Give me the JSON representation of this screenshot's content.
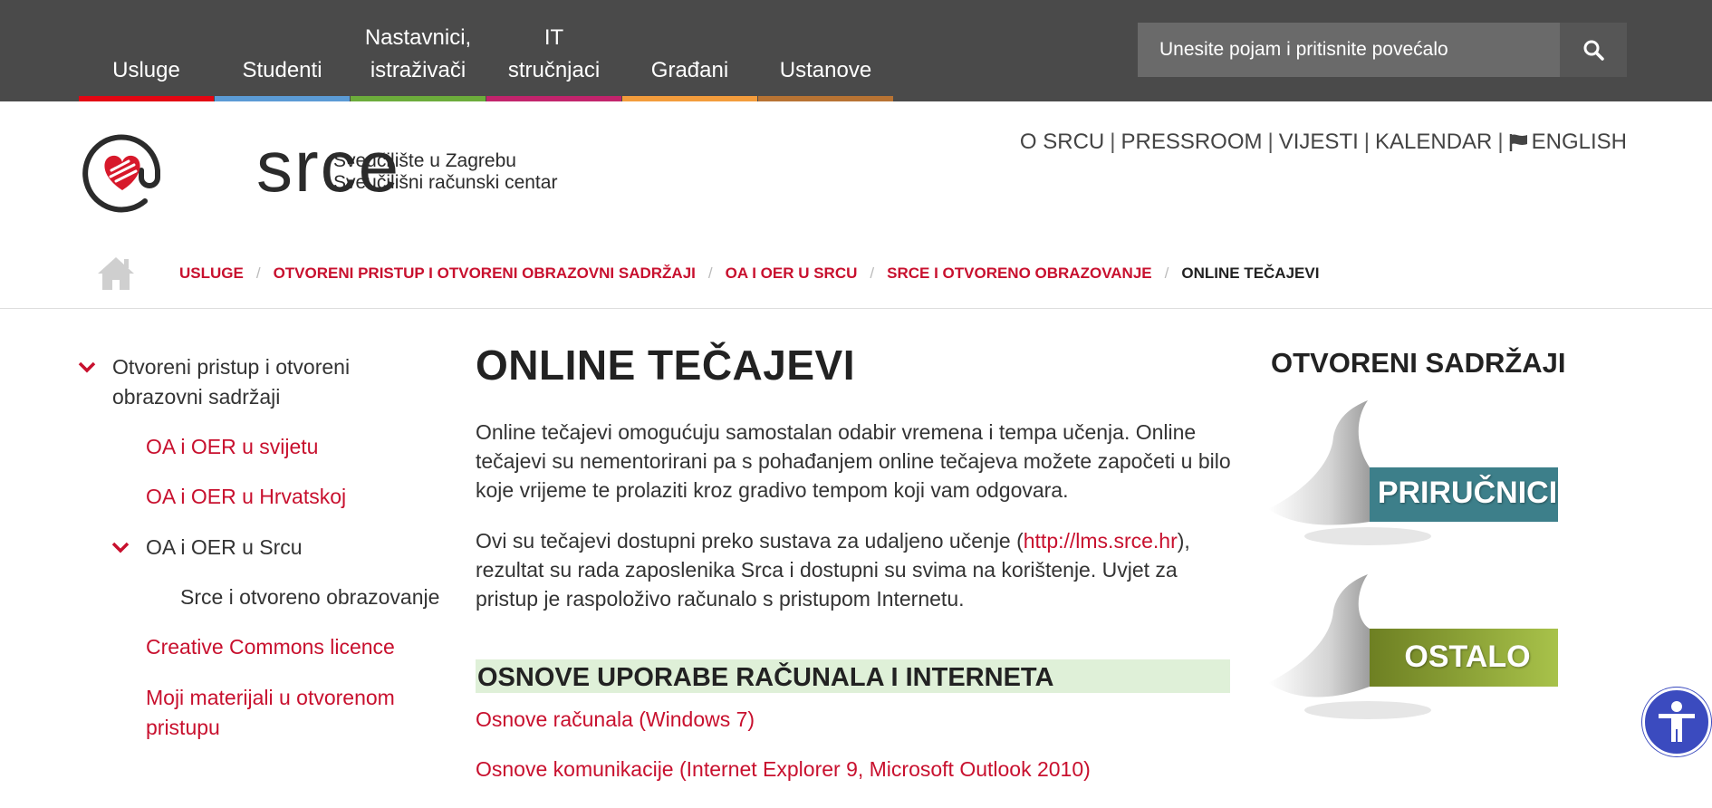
{
  "nav": {
    "items": [
      {
        "line1": "",
        "line2": "Usluge",
        "color": "#e30613"
      },
      {
        "line1": "",
        "line2": "Studenti",
        "color": "#5b9bd5"
      },
      {
        "line1": "Nastavnici,",
        "line2": "istraživači",
        "color": "#6cac3b"
      },
      {
        "line1": "IT",
        "line2": "stručnjaci",
        "color": "#c2246c"
      },
      {
        "line1": "",
        "line2": "Građani",
        "color": "#f39c3c"
      },
      {
        "line1": "",
        "line2": "Ustanove",
        "color": "#b87333"
      }
    ],
    "search_placeholder": "Unesite pojam i pritisnite povećalo",
    "search_icon": "magnifier-icon"
  },
  "header": {
    "logo_text": "srce",
    "logo_sub1": "Sveučilište u Zagrebu",
    "logo_sub2": "Sveučilišni računski centar",
    "links": [
      "O SRCU",
      "PRESSROOM",
      "VIJESTI",
      "KALENDAR",
      "ENGLISH"
    ],
    "separator": "|"
  },
  "breadcrumb": {
    "items": [
      "USLUGE",
      "OTVORENI PRISTUP I OTVORENI OBRAZOVNI SADRŽAJI",
      "OA I OER U SRCU",
      "SRCE I OTVORENO OBRAZOVANJE"
    ],
    "current": "ONLINE TEČAJEVI",
    "separator": "/"
  },
  "sidebar": {
    "parent1": "Otvoreni pristup i otvoreni",
    "parent2": "obrazovni sadržaji",
    "items": [
      "OA i OER u svijetu",
      "OA i OER u Hrvatskoj",
      "OA i OER u Srcu",
      "Srce i otvoreno obrazovanje",
      "Creative Commons licence"
    ],
    "last1": "Moji materijali u otvorenom",
    "last2": "pristupu"
  },
  "main": {
    "title": "ONLINE TEČAJEVI",
    "p1": "Online tečajevi omogućuju samostalan odabir vremena i tempa učenja. Online tečajevi su nementorirani pa s pohađanjem online tečajeva možete započeti u bilo koje vrijeme te prolaziti kroz gradivo tempom koji vam odgovara.",
    "p2_before": "Ovi su tečajevi dostupni preko sustava za udaljeno učenje (",
    "p2_link": "http://lms.srce.hr",
    "p2_after": "), rezultat su rada zaposlenika Srca i dostupni su svima na korištenje. Uvjet za pristup je raspoloživo računalo s pristupom Internetu.",
    "section": "OSNOVE UPORABE RAČUNALA I INTERNETA",
    "courses": [
      "Osnove računala (Windows 7)",
      "Osnove komunikacije (Internet Explorer 9, Microsoft Outlook 2010)"
    ]
  },
  "right": {
    "title": "OTVORENI SADRŽAJI",
    "banners": [
      {
        "label": "PRIRUČNICI",
        "color": "#3d7f8a"
      },
      {
        "label": "OSTALO",
        "color": "#8aa33a"
      }
    ]
  }
}
